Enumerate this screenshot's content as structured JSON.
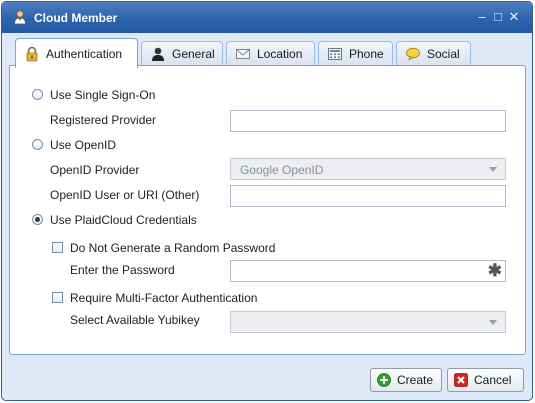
{
  "window": {
    "title": "Cloud Member",
    "controls": {
      "minimize": "–",
      "maximize": "□",
      "close": "✕"
    }
  },
  "tabs": [
    {
      "label": "Authentication",
      "icon": "lock-icon",
      "active": true
    },
    {
      "label": "General",
      "icon": "user-icon",
      "active": false
    },
    {
      "label": "Location",
      "icon": "envelope-icon",
      "active": false
    },
    {
      "label": "Phone",
      "icon": "phone-icon",
      "active": false
    },
    {
      "label": "Social",
      "icon": "speech-bubble-icon",
      "active": false
    }
  ],
  "auth": {
    "sso": {
      "option_label": "Use Single Sign-On",
      "selected": false,
      "provider_label": "Registered Provider",
      "provider_value": ""
    },
    "openid": {
      "option_label": "Use OpenID",
      "selected": false,
      "provider_label": "OpenID Provider",
      "provider_value": "Google OpenID",
      "uri_label": "OpenID User or URI (Other)",
      "uri_value": ""
    },
    "plaid": {
      "option_label": "Use PlaidCloud Credentials",
      "selected": true,
      "no_random_pw_label": "Do Not Generate a Random Password",
      "no_random_pw_checked": false,
      "password_label": "Enter the Password",
      "password_value": "",
      "password_required_mark": "✱",
      "mfa_label": "Require Multi-Factor Authentication",
      "mfa_checked": false,
      "yubikey_label": "Select Available Yubikey",
      "yubikey_value": ""
    }
  },
  "buttons": {
    "create": "Create",
    "cancel": "Cancel"
  },
  "colors": {
    "titlebar": "#2f64ad",
    "panel_border": "#7ba3d4",
    "window_bg": "#dfe8f6",
    "create_icon": "#2e9e2e",
    "cancel_icon": "#d0281e"
  }
}
